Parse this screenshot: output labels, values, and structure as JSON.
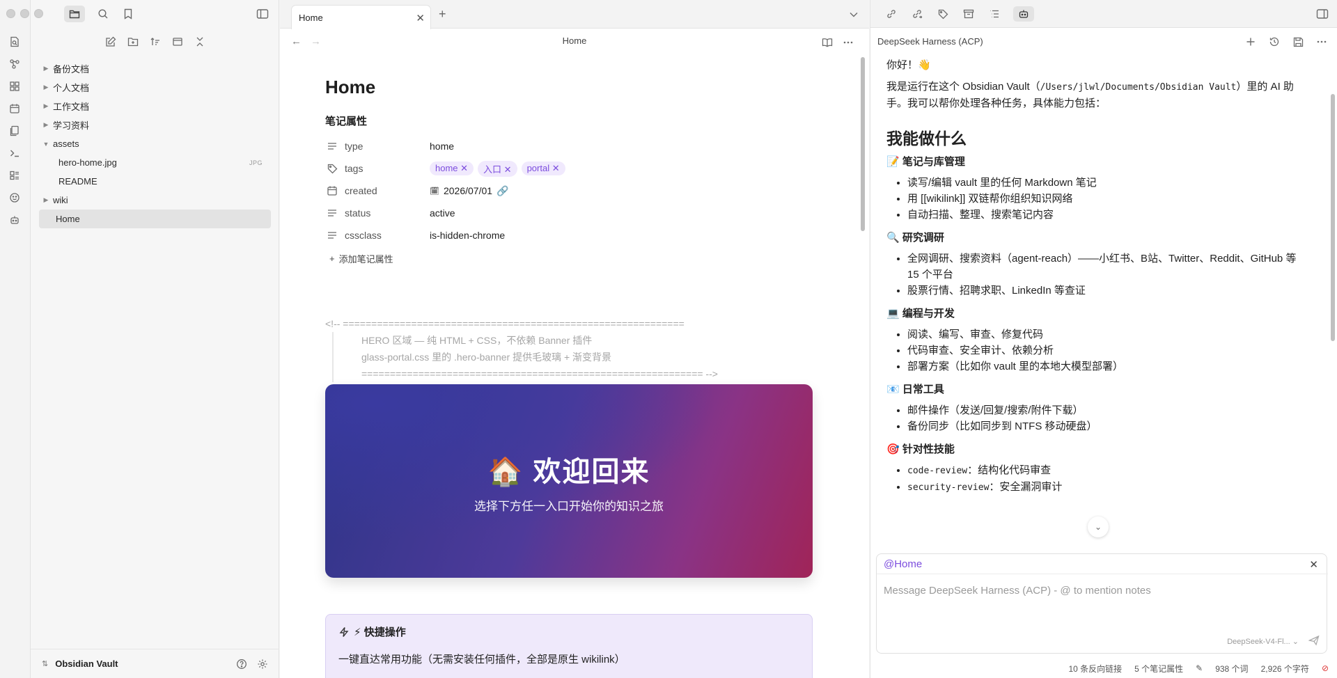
{
  "sidebar": {
    "items": [
      {
        "label": "备份文档",
        "kind": "folder",
        "expanded": false
      },
      {
        "label": "个人文档",
        "kind": "folder",
        "expanded": false
      },
      {
        "label": "工作文档",
        "kind": "folder",
        "expanded": false
      },
      {
        "label": "学习资料",
        "kind": "folder",
        "expanded": false
      },
      {
        "label": "assets",
        "kind": "folder",
        "expanded": true
      },
      {
        "label": "hero-home.jpg",
        "kind": "file",
        "ext": "JPG"
      },
      {
        "label": "README",
        "kind": "file"
      },
      {
        "label": "wiki",
        "kind": "folder",
        "expanded": false
      },
      {
        "label": "Home",
        "kind": "file",
        "active": true
      }
    ],
    "vault_name": "Obsidian Vault"
  },
  "tab": {
    "label": "Home"
  },
  "view": {
    "title": "Home"
  },
  "doc": {
    "title": "Home",
    "props_heading": "笔记属性",
    "props": [
      {
        "key": "type",
        "value": "home",
        "icon": "text-icon"
      },
      {
        "key": "tags",
        "tags": [
          "home",
          "入口",
          "portal"
        ],
        "icon": "tags-icon"
      },
      {
        "key": "created",
        "value": "2026/07/01",
        "icon": "calendar-icon"
      },
      {
        "key": "status",
        "value": "active",
        "icon": "text-icon"
      },
      {
        "key": "cssclass",
        "value": "is-hidden-chrome",
        "icon": "text-icon"
      }
    ],
    "add_property": "添加笔记属性",
    "comment": [
      "<!-- ============================================================",
      "HERO 区域 — 纯 HTML + CSS，不依赖 Banner 插件",
      "glass-portal.css 里的 .hero-banner 提供毛玻璃 + 渐变背景",
      "============================================================ -->"
    ],
    "hero_title": "🏠 欢迎回来",
    "hero_subtitle": "选择下方任一入口开始你的知识之旅",
    "quick_title": "⚡ 快捷操作",
    "quick_desc": "一键直达常用功能（无需安装任何插件，全部是原生 wikilink）"
  },
  "agent": {
    "title": "DeepSeek Harness (ACP)",
    "greeting": "你好！👋",
    "intro_1": "我是运行在这个 Obsidian Vault（",
    "intro_path": "/Users/jlwl/Documents/Obsidian Vault",
    "intro_2": "）里的 AI 助手。我可以帮你处理各种任务，具体能力包括：",
    "section_heading": "我能做什么",
    "groups": [
      {
        "title": "📝 笔记与库管理",
        "items": [
          "读写/编辑 vault 里的任何 Markdown 笔记",
          "用 [[wikilink]] 双链帮你组织知识网络",
          "自动扫描、整理、搜索笔记内容"
        ]
      },
      {
        "title": "🔍 研究调研",
        "items": [
          "全网调研、搜索资料（agent-reach）——小红书、B站、Twitter、Reddit、GitHub 等 15 个平台",
          "股票行情、招聘求职、LinkedIn 等查证"
        ]
      },
      {
        "title": "💻 编程与开发",
        "items": [
          "阅读、编写、审查、修复代码",
          "代码审查、安全审计、依赖分析",
          "部署方案（比如你 vault 里的本地大模型部署）"
        ]
      },
      {
        "title": "📧 日常工具",
        "items": [
          "邮件操作（发送/回复/搜索/附件下载）",
          "备份同步（比如同步到 NTFS 移动硬盘）"
        ]
      },
      {
        "title": "🎯 针对性技能",
        "items": []
      }
    ],
    "skills": [
      {
        "code": "code-review",
        "text": "：结构化代码审查"
      },
      {
        "code": "security-review",
        "text": "：安全漏洞审计"
      }
    ],
    "mention": "@Home",
    "placeholder": "Message DeepSeek Harness (ACP) - @ to mention notes",
    "model": "DeepSeek-V4-Fl..."
  },
  "status": {
    "backlinks": "10 条反向链接",
    "properties": "5 个笔记属性",
    "words": "938 个词",
    "chars": "2,926 个字符"
  },
  "colors": {
    "accent": "#7c4dde",
    "hero_start": "#2e3588",
    "hero_end": "#a02458",
    "quick_bg": "#efe9fb"
  }
}
